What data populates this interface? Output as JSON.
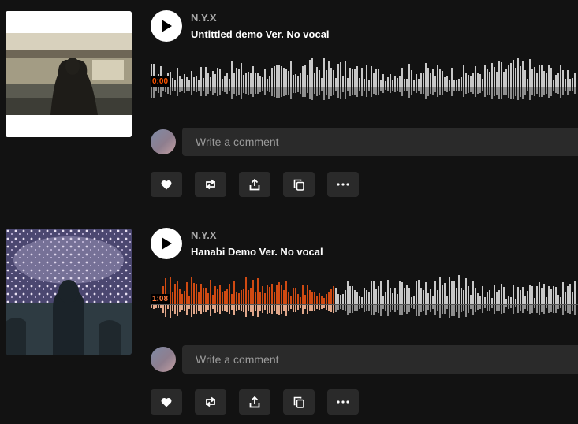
{
  "tracks": [
    {
      "artist": "N.Y.X",
      "title": "Untittled demo Ver. No vocal",
      "time": "0:00",
      "time_color": "#ff5500",
      "played_fraction": 0.0,
      "comment_placeholder": "Write a comment"
    },
    {
      "artist": "N.Y.X",
      "title": "Hanabi Demo Ver. No vocal",
      "time": "1:08",
      "time_color": "#ff7a3d",
      "played_fraction": 0.43,
      "comment_placeholder": "Write a comment"
    }
  ],
  "actions": [
    {
      "name": "like-button",
      "icon": "heart-icon"
    },
    {
      "name": "repost-button",
      "icon": "repost-icon"
    },
    {
      "name": "share-button",
      "icon": "share-icon"
    },
    {
      "name": "copy-link-button",
      "icon": "copy-icon"
    },
    {
      "name": "more-button",
      "icon": "more-icon"
    }
  ],
  "colors": {
    "background": "#121212",
    "wave_unplayed": "#c8c8c8",
    "wave_played": "#d04a12",
    "wave_played_reflection": "#e0a78a",
    "button_bg": "#2a2a2a"
  }
}
